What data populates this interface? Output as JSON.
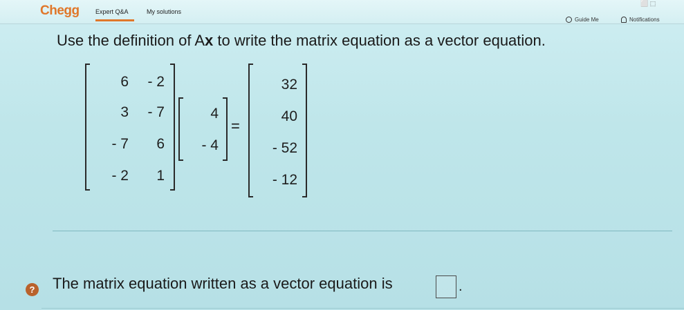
{
  "header": {
    "brand": "Chegg",
    "nav": [
      "Expert Q&A",
      "My solutions"
    ],
    "guide_label": "Guide Me",
    "notifications_label": "Notifications"
  },
  "question": {
    "prefix": "Use the definition of A",
    "bold": "x",
    "suffix": " to write the matrix equation as a vector equation."
  },
  "matrix_a": [
    [
      "6",
      "- 2"
    ],
    [
      "3",
      "- 7"
    ],
    [
      "- 7",
      "6"
    ],
    [
      "- 2",
      "1"
    ]
  ],
  "vector_x": [
    "4",
    "- 4"
  ],
  "vector_b": [
    "32",
    "40",
    "- 52",
    "- 12"
  ],
  "equals": "=",
  "answer": {
    "text": "The matrix equation written as a vector equation is",
    "value": "",
    "period": "."
  },
  "help_icon": "?",
  "colors": {
    "brand": "#e0772a",
    "help": "#b9622c"
  }
}
